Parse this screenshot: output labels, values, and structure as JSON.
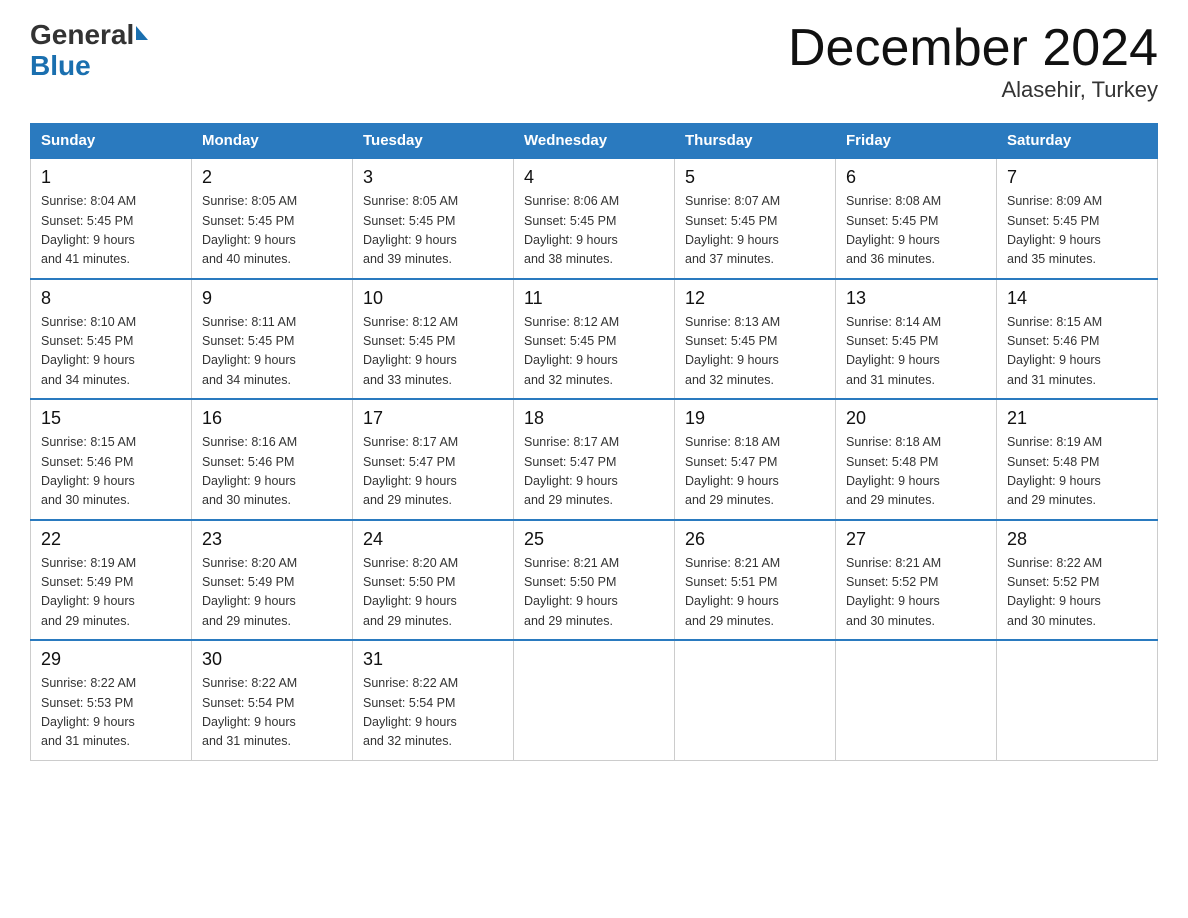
{
  "logo": {
    "general": "General",
    "blue": "Blue"
  },
  "title": "December 2024",
  "subtitle": "Alasehir, Turkey",
  "days_header": [
    "Sunday",
    "Monday",
    "Tuesday",
    "Wednesday",
    "Thursday",
    "Friday",
    "Saturday"
  ],
  "weeks": [
    [
      {
        "day": "1",
        "sunrise": "8:04 AM",
        "sunset": "5:45 PM",
        "daylight": "9 hours and 41 minutes."
      },
      {
        "day": "2",
        "sunrise": "8:05 AM",
        "sunset": "5:45 PM",
        "daylight": "9 hours and 40 minutes."
      },
      {
        "day": "3",
        "sunrise": "8:05 AM",
        "sunset": "5:45 PM",
        "daylight": "9 hours and 39 minutes."
      },
      {
        "day": "4",
        "sunrise": "8:06 AM",
        "sunset": "5:45 PM",
        "daylight": "9 hours and 38 minutes."
      },
      {
        "day": "5",
        "sunrise": "8:07 AM",
        "sunset": "5:45 PM",
        "daylight": "9 hours and 37 minutes."
      },
      {
        "day": "6",
        "sunrise": "8:08 AM",
        "sunset": "5:45 PM",
        "daylight": "9 hours and 36 minutes."
      },
      {
        "day": "7",
        "sunrise": "8:09 AM",
        "sunset": "5:45 PM",
        "daylight": "9 hours and 35 minutes."
      }
    ],
    [
      {
        "day": "8",
        "sunrise": "8:10 AM",
        "sunset": "5:45 PM",
        "daylight": "9 hours and 34 minutes."
      },
      {
        "day": "9",
        "sunrise": "8:11 AM",
        "sunset": "5:45 PM",
        "daylight": "9 hours and 34 minutes."
      },
      {
        "day": "10",
        "sunrise": "8:12 AM",
        "sunset": "5:45 PM",
        "daylight": "9 hours and 33 minutes."
      },
      {
        "day": "11",
        "sunrise": "8:12 AM",
        "sunset": "5:45 PM",
        "daylight": "9 hours and 32 minutes."
      },
      {
        "day": "12",
        "sunrise": "8:13 AM",
        "sunset": "5:45 PM",
        "daylight": "9 hours and 32 minutes."
      },
      {
        "day": "13",
        "sunrise": "8:14 AM",
        "sunset": "5:45 PM",
        "daylight": "9 hours and 31 minutes."
      },
      {
        "day": "14",
        "sunrise": "8:15 AM",
        "sunset": "5:46 PM",
        "daylight": "9 hours and 31 minutes."
      }
    ],
    [
      {
        "day": "15",
        "sunrise": "8:15 AM",
        "sunset": "5:46 PM",
        "daylight": "9 hours and 30 minutes."
      },
      {
        "day": "16",
        "sunrise": "8:16 AM",
        "sunset": "5:46 PM",
        "daylight": "9 hours and 30 minutes."
      },
      {
        "day": "17",
        "sunrise": "8:17 AM",
        "sunset": "5:47 PM",
        "daylight": "9 hours and 29 minutes."
      },
      {
        "day": "18",
        "sunrise": "8:17 AM",
        "sunset": "5:47 PM",
        "daylight": "9 hours and 29 minutes."
      },
      {
        "day": "19",
        "sunrise": "8:18 AM",
        "sunset": "5:47 PM",
        "daylight": "9 hours and 29 minutes."
      },
      {
        "day": "20",
        "sunrise": "8:18 AM",
        "sunset": "5:48 PM",
        "daylight": "9 hours and 29 minutes."
      },
      {
        "day": "21",
        "sunrise": "8:19 AM",
        "sunset": "5:48 PM",
        "daylight": "9 hours and 29 minutes."
      }
    ],
    [
      {
        "day": "22",
        "sunrise": "8:19 AM",
        "sunset": "5:49 PM",
        "daylight": "9 hours and 29 minutes."
      },
      {
        "day": "23",
        "sunrise": "8:20 AM",
        "sunset": "5:49 PM",
        "daylight": "9 hours and 29 minutes."
      },
      {
        "day": "24",
        "sunrise": "8:20 AM",
        "sunset": "5:50 PM",
        "daylight": "9 hours and 29 minutes."
      },
      {
        "day": "25",
        "sunrise": "8:21 AM",
        "sunset": "5:50 PM",
        "daylight": "9 hours and 29 minutes."
      },
      {
        "day": "26",
        "sunrise": "8:21 AM",
        "sunset": "5:51 PM",
        "daylight": "9 hours and 29 minutes."
      },
      {
        "day": "27",
        "sunrise": "8:21 AM",
        "sunset": "5:52 PM",
        "daylight": "9 hours and 30 minutes."
      },
      {
        "day": "28",
        "sunrise": "8:22 AM",
        "sunset": "5:52 PM",
        "daylight": "9 hours and 30 minutes."
      }
    ],
    [
      {
        "day": "29",
        "sunrise": "8:22 AM",
        "sunset": "5:53 PM",
        "daylight": "9 hours and 31 minutes."
      },
      {
        "day": "30",
        "sunrise": "8:22 AM",
        "sunset": "5:54 PM",
        "daylight": "9 hours and 31 minutes."
      },
      {
        "day": "31",
        "sunrise": "8:22 AM",
        "sunset": "5:54 PM",
        "daylight": "9 hours and 32 minutes."
      },
      null,
      null,
      null,
      null
    ]
  ]
}
